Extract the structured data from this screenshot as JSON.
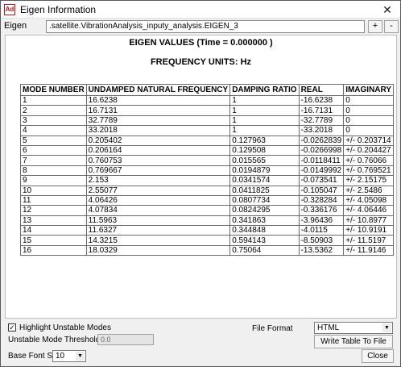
{
  "window": {
    "title": "Eigen Information",
    "app_icon_text": "Ad",
    "close_glyph": "✕"
  },
  "eigen": {
    "label": "Eigen",
    "value": ".satellite.VibrationAnalysis_inputy_analysis.EIGEN_3",
    "plus": "+",
    "minus": "-"
  },
  "report": {
    "title": "EIGEN VALUES (Time = 0.000000 )",
    "units": "FREQUENCY UNITS: Hz",
    "columns": [
      "MODE NUMBER",
      "UNDAMPED NATURAL FREQUENCY",
      "DAMPING RATIO",
      "REAL",
      "IMAGINARY"
    ],
    "rows": [
      [
        "1",
        "16.6238",
        "1",
        "-16.6238",
        "0"
      ],
      [
        "2",
        "16.7131",
        "1",
        "-16.7131",
        "0"
      ],
      [
        "3",
        "32.7789",
        "1",
        "-32.7789",
        "0"
      ],
      [
        "4",
        "33.2018",
        "1",
        "-33.2018",
        "0"
      ],
      [
        "5",
        "0.205402",
        "0.127963",
        "-0.0262839",
        "+/- 0.203714"
      ],
      [
        "6",
        "0.206164",
        "0.129508",
        "-0.0266998",
        "+/- 0.204427"
      ],
      [
        "7",
        "0.760753",
        "0.015565",
        "-0.0118411",
        "+/- 0.76066"
      ],
      [
        "8",
        "0.769667",
        "0.0194879",
        "-0.0149992",
        "+/- 0.769521"
      ],
      [
        "9",
        "2.153",
        "0.0341574",
        "-0.073541",
        "+/- 2.15175"
      ],
      [
        "10",
        "2.55077",
        "0.0411825",
        "-0.105047",
        "+/- 2.5486"
      ],
      [
        "11",
        "4.06426",
        "0.0807734",
        "-0.328284",
        "+/- 4.05098"
      ],
      [
        "12",
        "4.07834",
        "0.0824295",
        "-0.336176",
        "+/- 4.06446"
      ],
      [
        "13",
        "11.5963",
        "0.341863",
        "-3.96436",
        "+/- 10.8977"
      ],
      [
        "14",
        "11.6327",
        "0.344848",
        "-4.0115",
        "+/- 10.9191"
      ],
      [
        "15",
        "14.3215",
        "0.594143",
        "-8.50903",
        "+/- 11.5197"
      ],
      [
        "16",
        "18.0329",
        "0.75064",
        "-13.5362",
        "+/- 11.9146"
      ]
    ]
  },
  "controls": {
    "highlight_label": "Highlight Unstable Modes",
    "highlight_checked": true,
    "threshold_label": "Unstable Mode Threshold Value",
    "threshold_value": "0.0",
    "file_format_label": "File Format",
    "file_format_value": "HTML",
    "write_button": "Write Table To File",
    "base_font_label": "Base Font Size",
    "base_font_value": "10",
    "close_button": "Close"
  }
}
